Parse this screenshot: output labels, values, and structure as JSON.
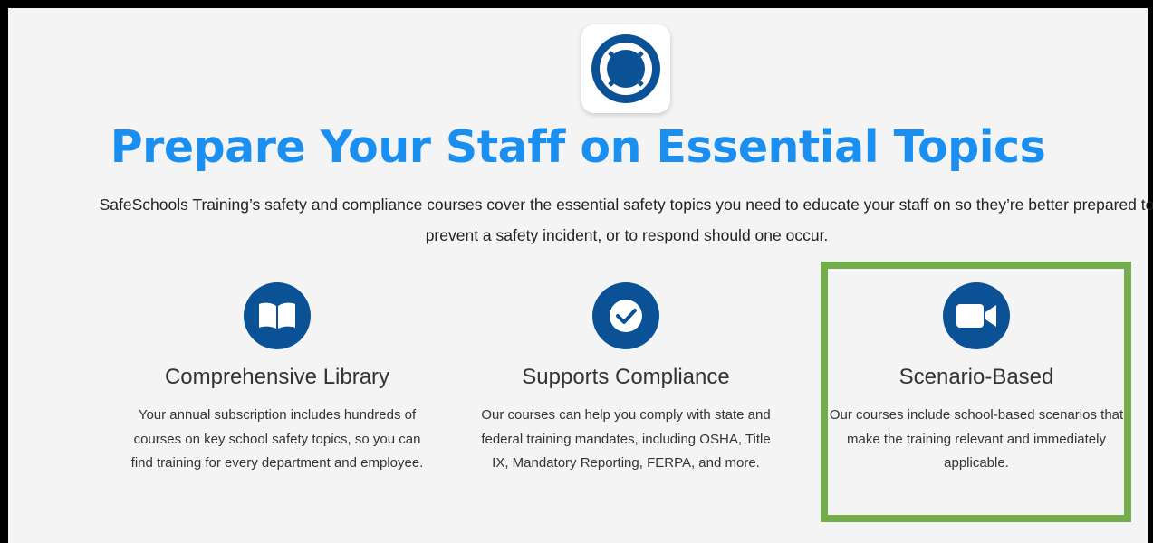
{
  "headline": "Prepare Your Staff on Essential Topics",
  "intro": "SafeSchools Training’s safety and compliance courses cover the essential safety topics you need to educate your staff on so they’re better prepared to prevent a safety incident, or to respond should one occur.",
  "colors": {
    "headline": "#1a8ff0",
    "icon_circle": "#0b5196",
    "highlight_border": "#72ac4b"
  },
  "app_icon": "lifebuoy-icon",
  "features": [
    {
      "icon": "book-icon",
      "title": "Comprehensive Library",
      "description": "Your annual subscription includes hundreds of courses on key school safety topics, so you can find training for every department and employee."
    },
    {
      "icon": "checkmark-icon",
      "title": "Supports Compliance",
      "description": "Our courses can help you comply with state and federal training mandates, including OSHA, Title IX, Mandatory Reporting, FERPA, and more."
    },
    {
      "icon": "video-camera-icon",
      "title": "Scenario-Based",
      "description": "Our courses include school-based scenarios that make the training relevant and immediately applicable."
    }
  ]
}
